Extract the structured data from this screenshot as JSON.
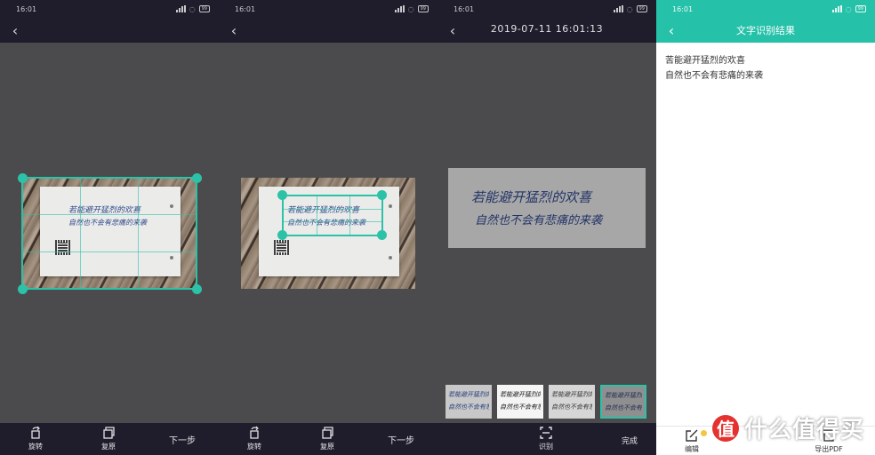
{
  "screen1": {
    "status_time": "16:01",
    "battery": "99",
    "handwriting": [
      "若能避开猛烈的欢喜",
      "自然也不会有悲痛的来袭"
    ],
    "toolbar": {
      "rotate": "旋转",
      "restore": "复原",
      "next": "下一步"
    }
  },
  "screen2": {
    "status_time": "16:01",
    "battery": "99",
    "handwriting": [
      "若能避开猛烈的欢喜",
      "自然也不会有悲痛的来袭"
    ],
    "toolbar": {
      "rotate": "旋转",
      "restore": "复原",
      "next": "下一步"
    }
  },
  "screen3": {
    "status_time": "16:01",
    "battery": "99",
    "title": "2019-07-11 16:01:13",
    "handwriting": [
      "若能避开猛烈的欢喜",
      "自然也不会有悲痛的来袭"
    ],
    "thumbnail_text": [
      "若能避开猛烈的欢喜",
      "自然也不会有悲痛的来袭"
    ],
    "toolbar": {
      "recognize": "识别",
      "done": "完成"
    }
  },
  "screen4": {
    "status_time": "16:01",
    "battery": "99",
    "title": "文字识别结果",
    "result_lines": [
      "苦能避开猛烈的欢喜",
      "自然也不会有悲痛的来袭"
    ],
    "toolbar": {
      "edit": "编辑",
      "export": "导出PDF"
    }
  },
  "watermark": {
    "logo": "值",
    "text": "什么值得买"
  },
  "colors": {
    "accent": "#2cc2a8",
    "bar": "#1f1d2b",
    "canvas": "#4b4b4d"
  }
}
